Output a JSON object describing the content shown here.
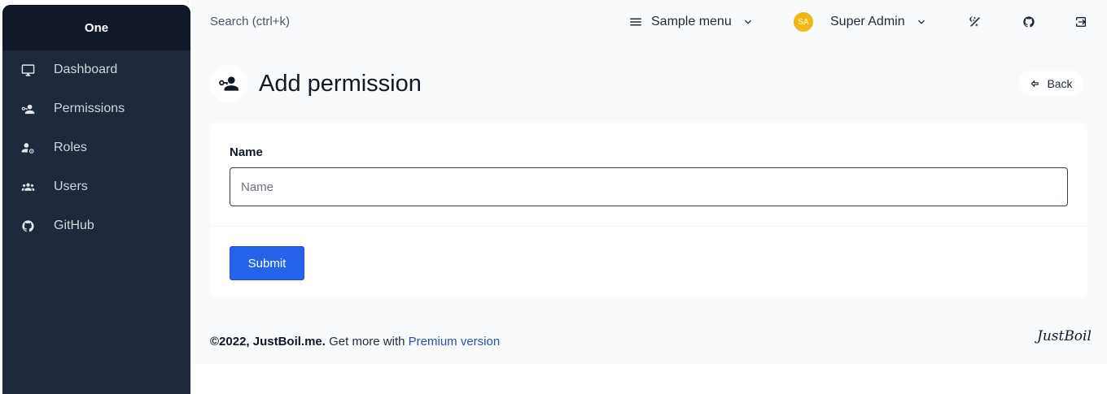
{
  "sidebar": {
    "brand": "One",
    "items": [
      {
        "label": "Dashboard",
        "icon": "monitor-icon"
      },
      {
        "label": "Permissions",
        "icon": "account-key-icon"
      },
      {
        "label": "Roles",
        "icon": "account-lock-icon"
      },
      {
        "label": "Users",
        "icon": "account-group-icon"
      },
      {
        "label": "GitHub",
        "icon": "github-icon"
      }
    ]
  },
  "navbar": {
    "search_placeholder": "Search (ctrl+k)",
    "sample_menu": "Sample menu",
    "user_initials": "SA",
    "user_name": "Super Admin"
  },
  "page": {
    "title": "Add permission",
    "back_label": "Back"
  },
  "form": {
    "name_label": "Name",
    "name_placeholder": "Name",
    "name_value": "",
    "submit_label": "Submit"
  },
  "footer": {
    "copyright": "©2022, JustBoil.me.",
    "text": " Get more with ",
    "link": "Premium version",
    "logo": "JustBoil"
  },
  "colors": {
    "sidebar_bg": "#1e293b",
    "brand_bg": "#111827",
    "primary": "#2563eb",
    "avatar": "#f2b714",
    "link": "#2b50a8"
  }
}
